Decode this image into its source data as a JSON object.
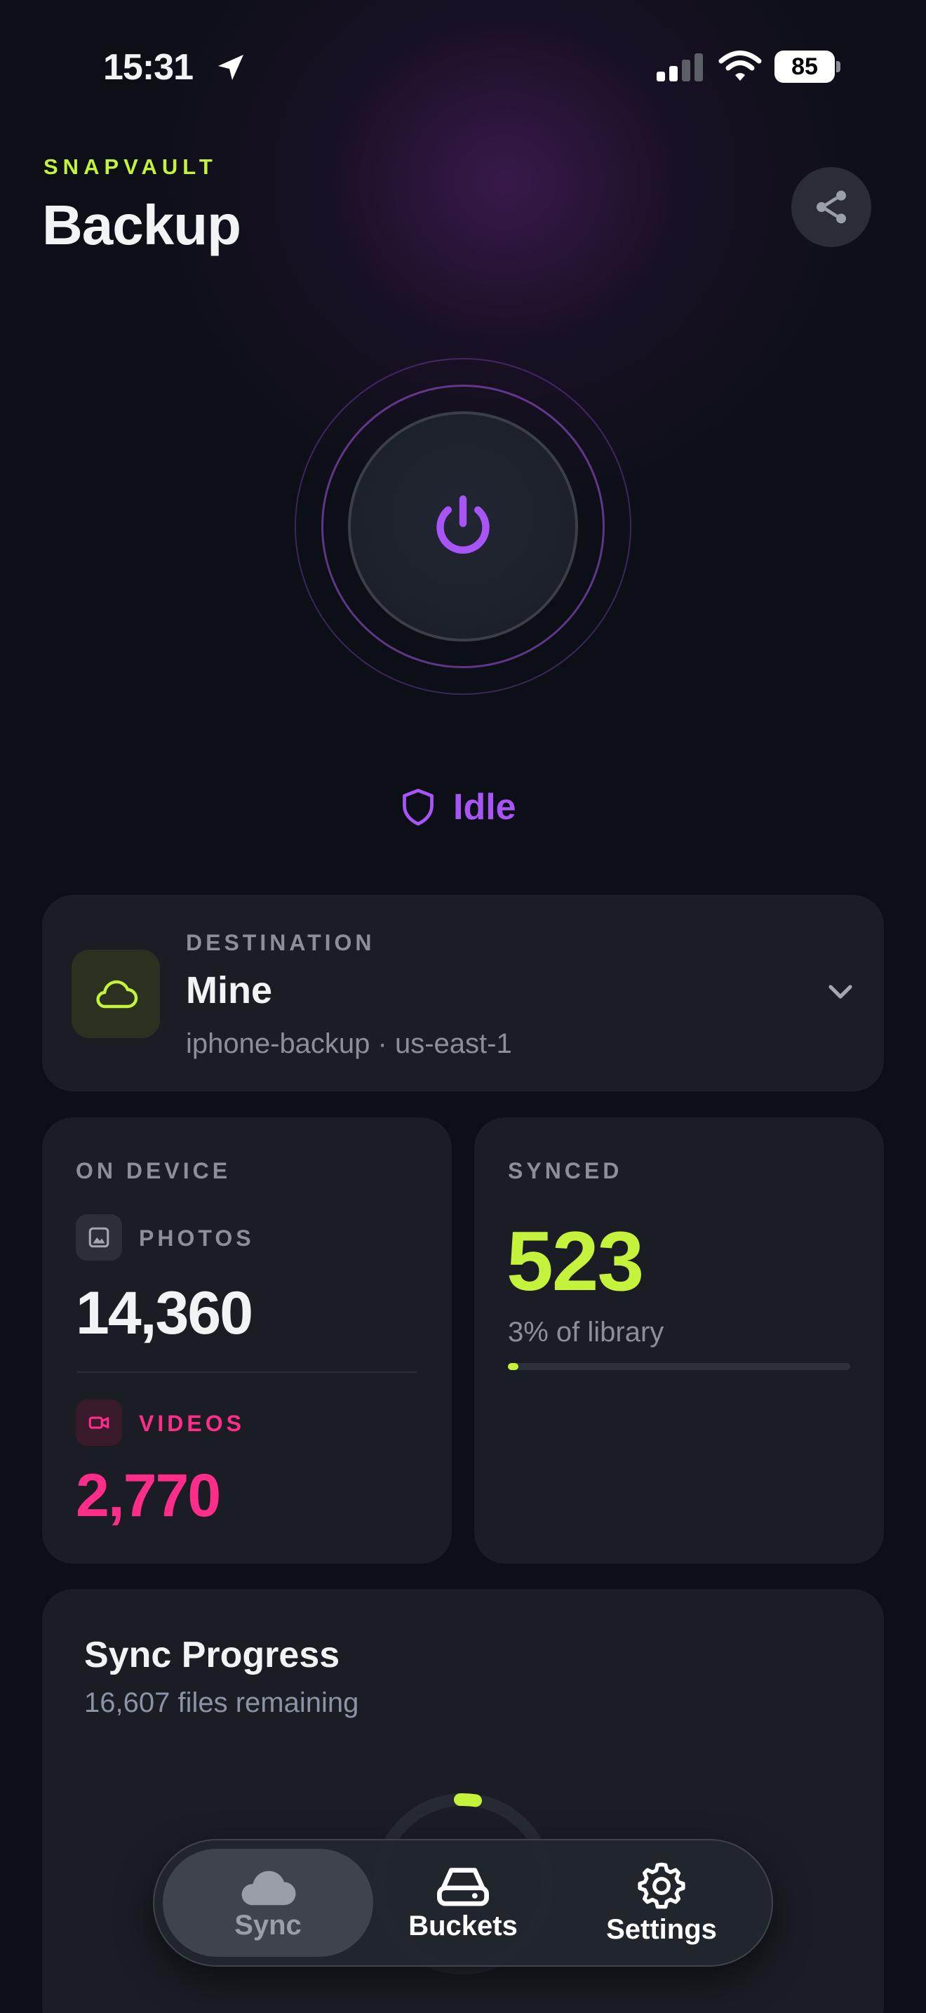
{
  "status_bar": {
    "time": "15:31",
    "battery": "85"
  },
  "header": {
    "brand": "SNAPVAULT",
    "title": "Backup"
  },
  "power": {
    "state_label": "Idle"
  },
  "destination": {
    "caption": "DESTINATION",
    "name": "Mine",
    "subtitle": "iphone-backup · us-east-1"
  },
  "on_device": {
    "caption": "ON DEVICE",
    "photos_label": "PHOTOS",
    "photos_count": "14,360",
    "videos_label": "VIDEOS",
    "videos_count": "2,770"
  },
  "synced": {
    "caption": "SYNCED",
    "count": "523",
    "percent_text": "3% of library",
    "progress_fraction": 0.03
  },
  "sync_progress": {
    "title": "Sync Progress",
    "subtitle": "16,607 files remaining"
  },
  "tabs": [
    {
      "label": "Sync",
      "icon": "cloud-icon",
      "selected": true
    },
    {
      "label": "Buckets",
      "icon": "drive-icon",
      "selected": false
    },
    {
      "label": "Settings",
      "icon": "gear-icon",
      "selected": false
    }
  ],
  "colors": {
    "accent_lime": "#c5f23a",
    "accent_purple": "#a855f7",
    "accent_pink": "#ff2d8a",
    "background": "#0c0f15",
    "card": "#1a1d24"
  }
}
